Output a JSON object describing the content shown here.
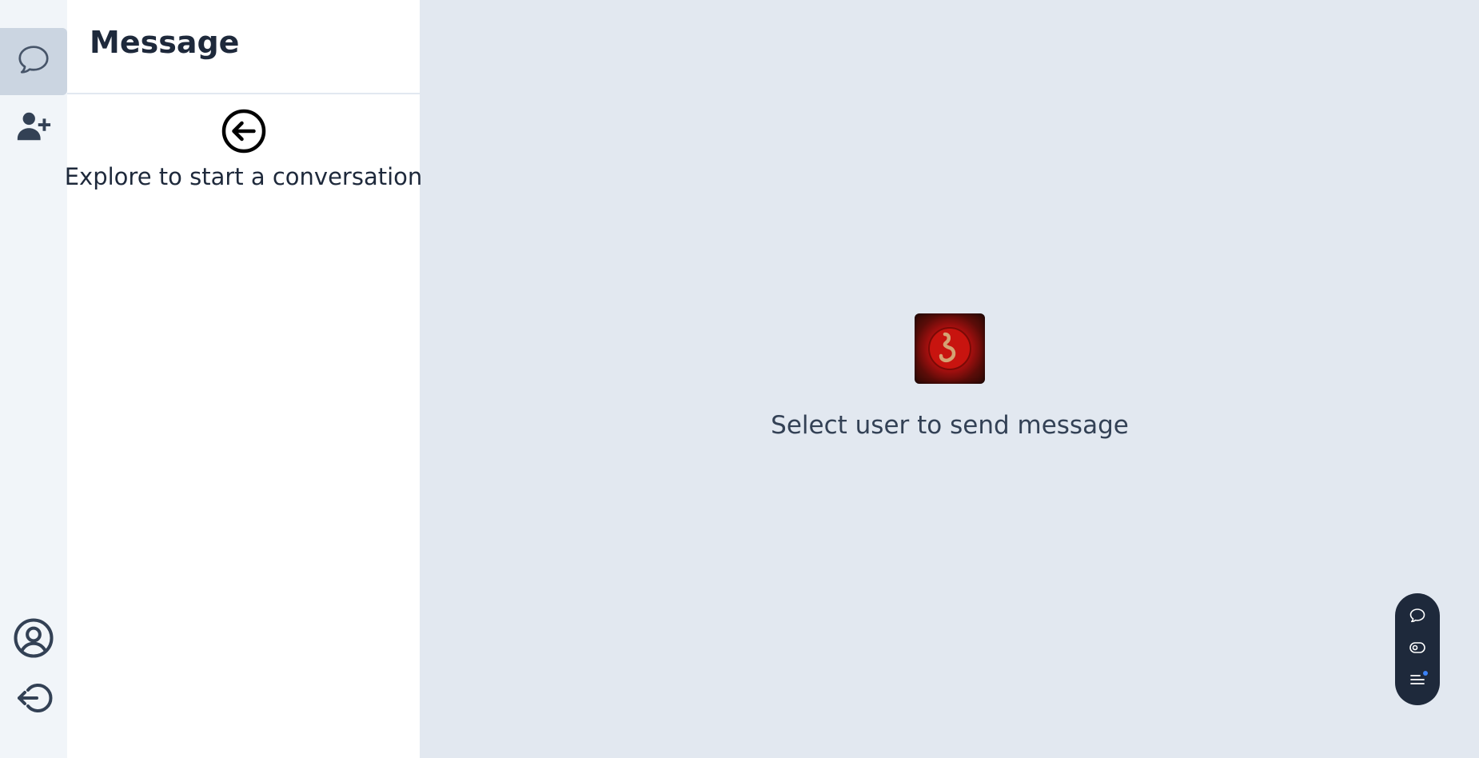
{
  "panel": {
    "title": "Message",
    "empty_state_text": "Explore to start a conversation"
  },
  "main": {
    "placeholder_text": "Select user to send message"
  },
  "rail": {
    "items": [
      {
        "icon": "chat-bubble-icon",
        "active": true
      },
      {
        "icon": "add-user-icon",
        "active": false
      }
    ],
    "bottom_items": [
      {
        "icon": "user-circle-icon"
      },
      {
        "icon": "logout-icon"
      }
    ]
  },
  "floating_toolbar": {
    "items": [
      {
        "icon": "chat-icon"
      },
      {
        "icon": "eye-icon"
      },
      {
        "icon": "menu-icon"
      }
    ]
  },
  "colors": {
    "rail_bg": "#f1f5f9",
    "active_bg": "#cbd5e1",
    "main_bg": "#e2e8f0",
    "floating_bg": "#1e293b",
    "notification_dot": "#3b82f6"
  }
}
